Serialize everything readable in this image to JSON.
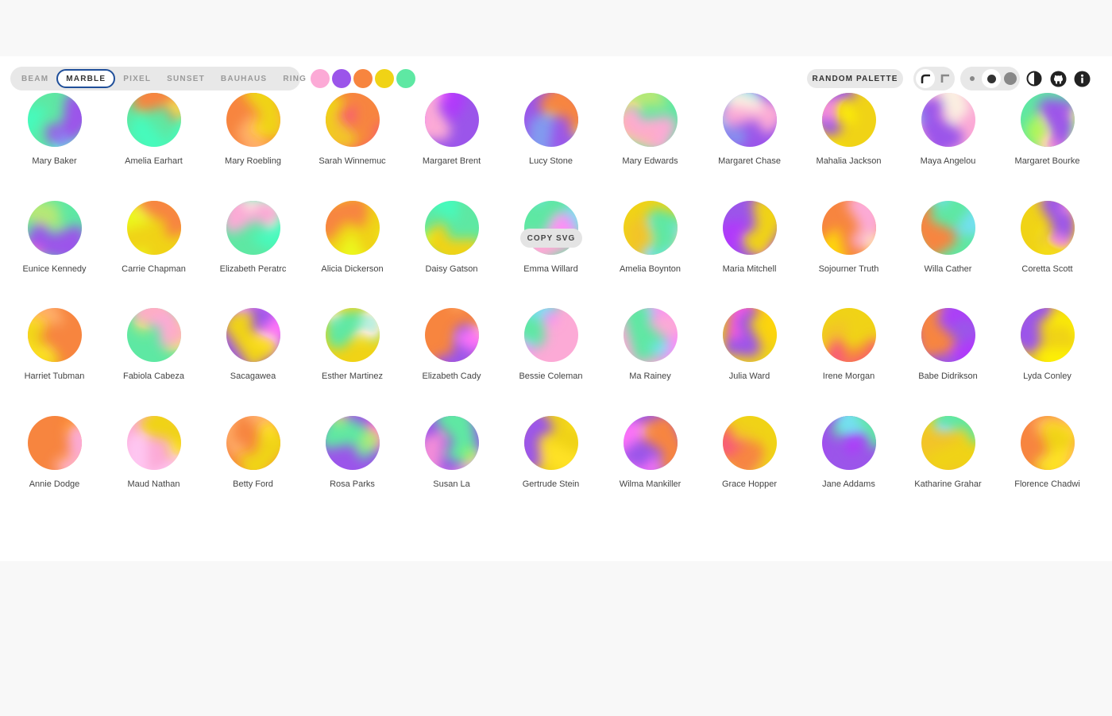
{
  "variants": [
    {
      "label": "BEAM",
      "active": false
    },
    {
      "label": "MARBLE",
      "active": true
    },
    {
      "label": "PIXEL",
      "active": false
    },
    {
      "label": "SUNSET",
      "active": false
    },
    {
      "label": "BAUHAUS",
      "active": false
    },
    {
      "label": "RING",
      "active": false
    }
  ],
  "palette": [
    "#fcaad6",
    "#9b55ea",
    "#f7853f",
    "#f0d316",
    "#5ee8a3"
  ],
  "random_palette_label": "RANDOM PALETTE",
  "shape_options": [
    {
      "icon": "rounded-corner-icon",
      "active": true
    },
    {
      "icon": "square-corner-icon",
      "active": false
    }
  ],
  "size_options": [
    {
      "icon": "small-dot-icon",
      "active": false
    },
    {
      "icon": "medium-dot-icon",
      "active": true
    },
    {
      "icon": "large-dot-icon",
      "active": false
    }
  ],
  "header_icons": [
    "contrast-icon",
    "github-icon",
    "info-icon"
  ],
  "copy_svg_label": "COPY SVG",
  "names": [
    "Mary Baker",
    "Amelia Earhart",
    "Mary Roebling",
    "Sarah Winnemuc",
    "Margaret Brent",
    "Lucy Stone",
    "Mary Edwards",
    "Margaret Chase",
    "Mahalia Jackson",
    "Maya Angelou",
    "Margaret Bourke",
    "Eunice Kennedy",
    "Carrie Chapman",
    "Elizabeth Peratrc",
    "Alicia Dickerson",
    "Daisy Gatson",
    "Emma Willard",
    "Amelia Boynton",
    "Maria Mitchell",
    "Sojourner Truth",
    "Willa Cather",
    "Coretta Scott",
    "Harriet Tubman",
    "Fabiola Cabeza",
    "Sacagawea",
    "Esther Martinez",
    "Elizabeth Cady",
    "Bessie Coleman",
    "Ma Rainey",
    "Julia Ward",
    "Irene Morgan",
    "Babe Didrikson",
    "Lyda Conley",
    "Annie Dodge",
    "Maud Nathan",
    "Betty Ford",
    "Rosa Parks",
    "Susan La",
    "Gertrude Stein",
    "Wilma Mankiller",
    "Grace Hopper",
    "Jane Addams",
    "Katharine Grahar",
    "Florence Chadwi"
  ]
}
